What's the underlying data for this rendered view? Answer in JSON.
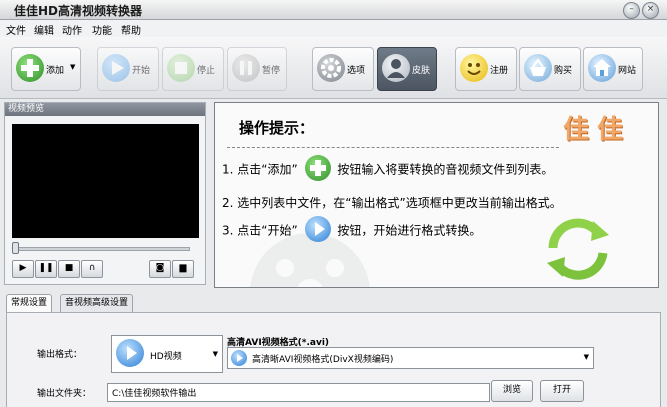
{
  "window": {
    "title": "佳佳HD高清视频转换器"
  },
  "menu": [
    "文件",
    "编辑",
    "动作",
    "功能",
    "帮助"
  ],
  "toolbar": {
    "add": "添加",
    "start": "开始",
    "stop": "停止",
    "pause": "暂停",
    "options": "选项",
    "skin": "皮肤",
    "register": "注册",
    "buy": "购买",
    "website": "网站"
  },
  "preview": {
    "header": "视频预览"
  },
  "tips": {
    "title": "操作提示：",
    "brand": "佳佳",
    "step1_pre": "1. 点击“添加”",
    "step1_post": "按钮输入将要转换的音视频文件到列表。",
    "step2": "2. 选中列表中文件，在“输出格式”选项框中更改当前输出格式。",
    "step3_pre": "3. 点击“开始”",
    "step3_post": "按钮，开始进行格式转换。"
  },
  "settings": {
    "tabs": [
      "常规设置",
      "音视频高级设置"
    ],
    "output_format_label": "输出格式：",
    "format_category": "HD视频",
    "format_title": "高清AVI视频格式(*.avi)",
    "format_detail": "高清晰AVI视频格式(DivX视频编码)",
    "output_folder_label": "输出文件夹：",
    "output_folder": "C:\\佳佳视频软件输出",
    "browse": "浏览",
    "open": "打开"
  },
  "colors": {
    "accent_green": "#3ea23a",
    "accent_blue": "#2a7fd4",
    "active_skin": "#5c6672"
  }
}
